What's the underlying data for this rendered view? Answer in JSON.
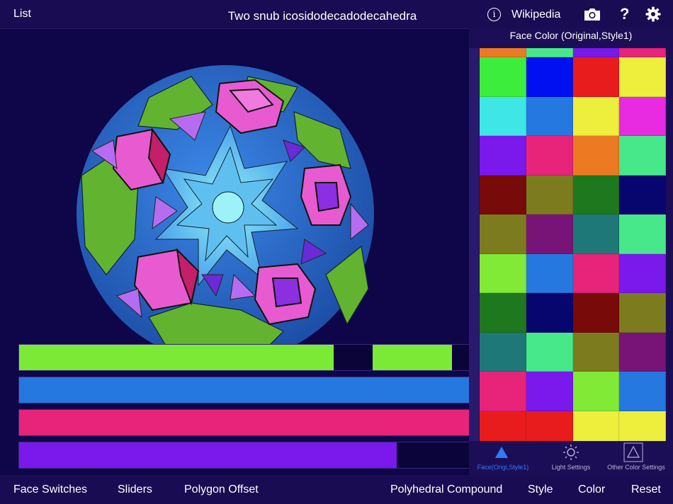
{
  "header": {
    "list_label": "List",
    "title": "Two snub icosidodecadodecahedra",
    "info_glyph": "i",
    "wikipedia_label": "Wikipedia",
    "help_glyph": "?"
  },
  "sliders": [
    {
      "value_fraction": 0.7,
      "color": "#7bea37"
    },
    {
      "value_fraction": 1.0,
      "color": "#2478e0"
    },
    {
      "value_fraction": 1.0,
      "color": "#e8237a"
    },
    {
      "value_fraction": 0.84,
      "color": "#7b18ec"
    }
  ],
  "color_panel": {
    "title": "Face Color (Original,Style1)",
    "partial_row": [
      "#ec7a22",
      "#47e88a",
      "#7b18ec",
      "#e8237a"
    ],
    "rows": [
      [
        "#3ded3d",
        "#0010f0",
        "#e81c1c",
        "#eeee3c"
      ],
      [
        "#3fe6e6",
        "#2478e0",
        "#eeee3c",
        "#e82ae0"
      ],
      [
        "#7b18ec",
        "#e8237a",
        "#ec7a22",
        "#47e88a"
      ],
      [
        "#780a0a",
        "#7c7c1e",
        "#1e781e",
        "#06066e"
      ],
      [
        "#7c7c1e",
        "#781478",
        "#1e7878",
        "#47e88a"
      ],
      [
        "#80ea37",
        "#2478e0",
        "#e8237a",
        "#7b18ec"
      ],
      [
        "#1e781e",
        "#06066e",
        "#780a0a",
        "#7c7c1e"
      ],
      [
        "#1e7878",
        "#47e88a",
        "#7c7c1e",
        "#781478"
      ],
      [
        "#e8237a",
        "#7b18ec",
        "#80ea37",
        "#2478e0"
      ],
      [
        "#e81c1c",
        "#e81c1c",
        "#eeee3c",
        "#eeee3c"
      ]
    ],
    "tabs": [
      {
        "label": "Face(Origi,Style1)",
        "icon": "triangle-filled-icon",
        "active": true
      },
      {
        "label": "Light Settings",
        "icon": "sun-icon",
        "active": false
      },
      {
        "label": "Other Color Settings",
        "icon": "triangle-outline-icon",
        "active": false
      }
    ]
  },
  "toolbar": {
    "face_switches": "Face Switches",
    "sliders": "Sliders",
    "polygon_offset": "Polygon Offset",
    "polyhedral_compound": "Polyhedral Compound",
    "style": "Style",
    "color": "Color",
    "reset": "Reset"
  },
  "colors": {
    "accent_blue": "#2e7bff",
    "bar_bg": "#1a0c52",
    "viewport_bg": "#0e0648"
  }
}
